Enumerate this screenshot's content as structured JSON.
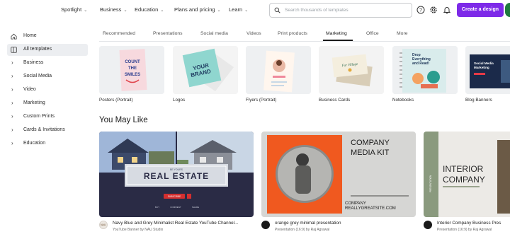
{
  "topnav": [
    {
      "label": "Spotlight"
    },
    {
      "label": "Business"
    },
    {
      "label": "Education"
    },
    {
      "label": "Plans and pricing"
    },
    {
      "label": "Learn"
    }
  ],
  "search": {
    "placeholder": "Search thousands of templates"
  },
  "header": {
    "create_label": "Create a design"
  },
  "sidebar": {
    "items": [
      {
        "label": "Home"
      },
      {
        "label": "All templates"
      },
      {
        "label": "Business"
      },
      {
        "label": "Social Media"
      },
      {
        "label": "Video"
      },
      {
        "label": "Marketing"
      },
      {
        "label": "Custom Prints"
      },
      {
        "label": "Cards & Invitations"
      },
      {
        "label": "Education"
      }
    ]
  },
  "tabs": [
    {
      "label": "Recommended"
    },
    {
      "label": "Presentations"
    },
    {
      "label": "Social media"
    },
    {
      "label": "Videos"
    },
    {
      "label": "Print products"
    },
    {
      "label": "Marketing"
    },
    {
      "label": "Office"
    },
    {
      "label": "More"
    }
  ],
  "categories": [
    {
      "label": "Posters (Portrait)",
      "art": {
        "line1": "COUNT",
        "line2": "THE",
        "line3": "SMILES"
      }
    },
    {
      "label": "Logos",
      "art": {
        "line1": "YOUR",
        "line2": "BRAND"
      }
    },
    {
      "label": "Flyers (Portrait)"
    },
    {
      "label": "Business Cards",
      "art": {
        "line1": "Fur Village"
      }
    },
    {
      "label": "Notebooks",
      "art": {
        "line1": "Drop",
        "line2": "Everything",
        "line3": "and Read!"
      }
    },
    {
      "label": "Blog Banners",
      "art": {
        "line1": "Social Media",
        "line2": "Marketing"
      }
    }
  ],
  "section": {
    "title": "You May Like"
  },
  "templates": [
    {
      "title": "Navy Blue and Grey Minimalist Real Estate YouTube Channel...",
      "subtitle": "YouTube Banner by NAU Studio",
      "art": {
        "heading": "REAL ESTATE",
        "kicker": "BE YOURS",
        "button": "SUBSCRIBE",
        "tags": [
          "BUY",
          "COMMENT",
          "SHARE"
        ]
      },
      "avatar_text": "NAU"
    },
    {
      "title": "orange grey minimal presentation",
      "subtitle": "Presentation (16:9) by Raj Agrawal",
      "art": {
        "heading1": "COMPANY",
        "heading2": "MEDIA KIT",
        "footer1": "COMPANY",
        "footer2": "REALLYGREATSITE.COM"
      }
    },
    {
      "title": "Interior Company Business Pres",
      "subtitle": "Presentation (16:9) by Raj Agrawal",
      "art": {
        "heading1": "INTERIOR",
        "heading2": "COMPANY",
        "side": "PRESENTATION"
      }
    }
  ],
  "colors": {
    "accent": "#7d2ae8",
    "navy": "#23233a",
    "orange": "#f0591f"
  }
}
